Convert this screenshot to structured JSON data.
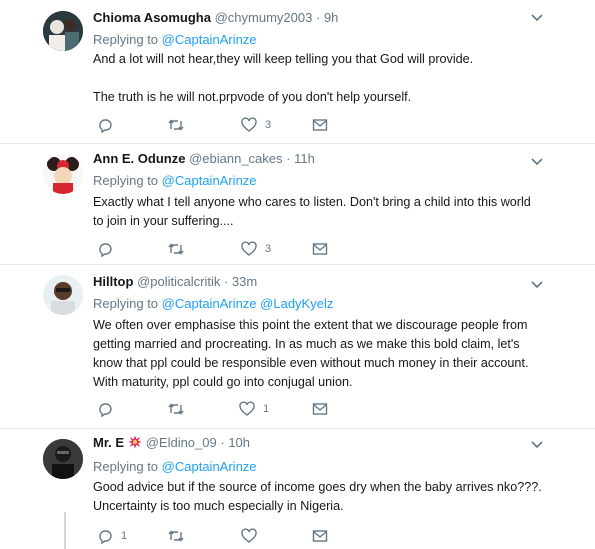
{
  "tweets": [
    {
      "name": "Chioma Asomugha",
      "handle": "@chymumy2003",
      "time": "9h",
      "replying_prefix": "Replying to",
      "mentions": [
        "@CaptainArinze"
      ],
      "text": [
        "And a lot will not hear,they will keep telling you that God will provide.",
        "",
        "The truth is he will not.prpvode of you don't help yourself."
      ],
      "reply_count": "",
      "retweet_count": "",
      "like_count": "3"
    },
    {
      "name": "Ann E. Odunze",
      "handle": "@ebiann_cakes",
      "time": "11h",
      "replying_prefix": "Replying to",
      "mentions": [
        "@CaptainArinze"
      ],
      "text": [
        "Exactly what I tell anyone who cares to listen. Don't bring a child into this world",
        "to join in your suffering...."
      ],
      "reply_count": "",
      "retweet_count": "",
      "like_count": "3"
    },
    {
      "name": "Hilltop",
      "handle": "@politicalcritik",
      "time": "33m",
      "replying_prefix": "Replying to",
      "mentions": [
        "@CaptainArinze",
        "@LadyKyelz"
      ],
      "text": [
        "We often over emphasise this point the extent that we discourage people from",
        "getting married and procreating. In as much as we make this bold claim, let's",
        "know that ppl could be responsible even without much money in their account.",
        "With maturity, ppl could go into conjugal union."
      ],
      "reply_count": "",
      "retweet_count": "",
      "like_count": "1"
    },
    {
      "name": "Mr. E",
      "handle": "@Eldino_09",
      "time": "10h",
      "replying_prefix": "Replying to",
      "mentions": [
        "@CaptainArinze"
      ],
      "text": [
        "Good advice but if the source of income goes dry when the baby arrives nko???.",
        "Uncertainty is too much especially in Nigeria."
      ],
      "reply_count": "1",
      "retweet_count": "",
      "like_count": ""
    }
  ],
  "colors": {
    "link": "#1da1f2",
    "secondary_text": "#657786",
    "divider": "#e6ecf0",
    "name_emoji": "#e0245e"
  },
  "icons": [
    "reply-icon",
    "retweet-icon",
    "like-icon",
    "message-icon",
    "chevron-down-icon",
    "fire-emoji-icon"
  ]
}
